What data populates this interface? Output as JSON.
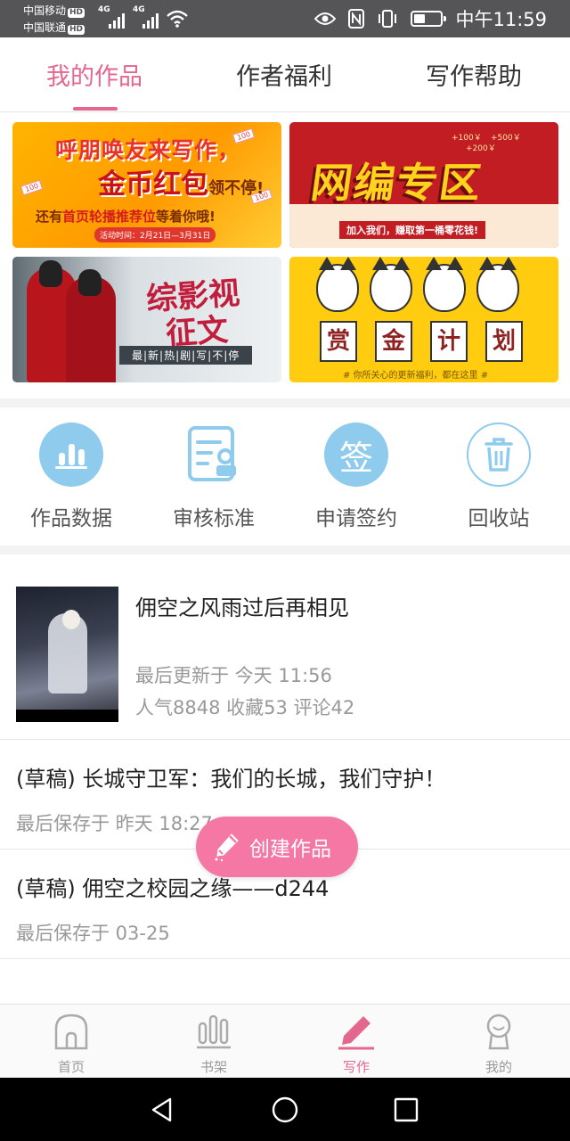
{
  "status_bar": {
    "carrier1": "中国移动",
    "carrier2": "中国联通",
    "hd": "HD",
    "net1": "4G",
    "net2": "4G",
    "time": "中午11:59",
    "icons": [
      "eye-icon",
      "nfc-icon",
      "vibrate-icon",
      "battery-icon"
    ]
  },
  "tabs": [
    {
      "label": "我的作品",
      "active": true
    },
    {
      "label": "作者福利",
      "active": false
    },
    {
      "label": "写作帮助",
      "active": false
    }
  ],
  "banners": {
    "b1": {
      "line1": "呼朋唤友来写作，",
      "line2": "金币红包",
      "line2_tail": "领不停!",
      "line3_pre": "还有",
      "line3_hl": "首页轮播推荐位",
      "line3_post": "等着你哦!",
      "date": "活动时间：2月21日—3月31日",
      "coupon": "100"
    },
    "b2": {
      "title": "网编专区",
      "sub": "加入我们，赚取第一桶零花钱!",
      "money1": "+100￥",
      "money2": "+500￥",
      "money3": "+200￥"
    },
    "b3": {
      "title1": "综影视",
      "title2": "征文",
      "sub": "最|新|热|剧|写|不|停"
    },
    "b4": {
      "chars": [
        "赏",
        "金",
        "计",
        "划"
      ],
      "note": "# 你所关心的更新福利，都在这里 #"
    }
  },
  "shortcuts": [
    {
      "label": "作品数据",
      "icon": "bar-chart-icon"
    },
    {
      "label": "审核标准",
      "icon": "document-check-icon"
    },
    {
      "label": "申请签约",
      "icon": "sign-icon",
      "glyph": "签"
    },
    {
      "label": "回收站",
      "icon": "trash-icon"
    }
  ],
  "works": {
    "featured": {
      "title": "佣空之风雨过后再相见",
      "updated": "最后更新于 今天 11:56",
      "stats": "人气8848 收藏53 评论42"
    },
    "drafts": [
      {
        "title": "(草稿) 长城守卫军：我们的长城，我们守护！",
        "saved": "最后保存于 昨天 18:27"
      },
      {
        "title": "(草稿) 佣空之校园之缘——d244",
        "saved": "最后保存于 03-25"
      }
    ]
  },
  "fab": {
    "label": "创建作品",
    "icon": "pencil-icon"
  },
  "bottom_nav": [
    {
      "label": "首页",
      "icon": "home-icon",
      "active": false
    },
    {
      "label": "书架",
      "icon": "bookshelf-icon",
      "active": false
    },
    {
      "label": "写作",
      "icon": "pen-icon",
      "active": true
    },
    {
      "label": "我的",
      "icon": "profile-icon",
      "active": false
    }
  ],
  "colors": {
    "accent": "#e4678d",
    "fab": "#f478a3",
    "icon_blue": "#8fcbed"
  }
}
